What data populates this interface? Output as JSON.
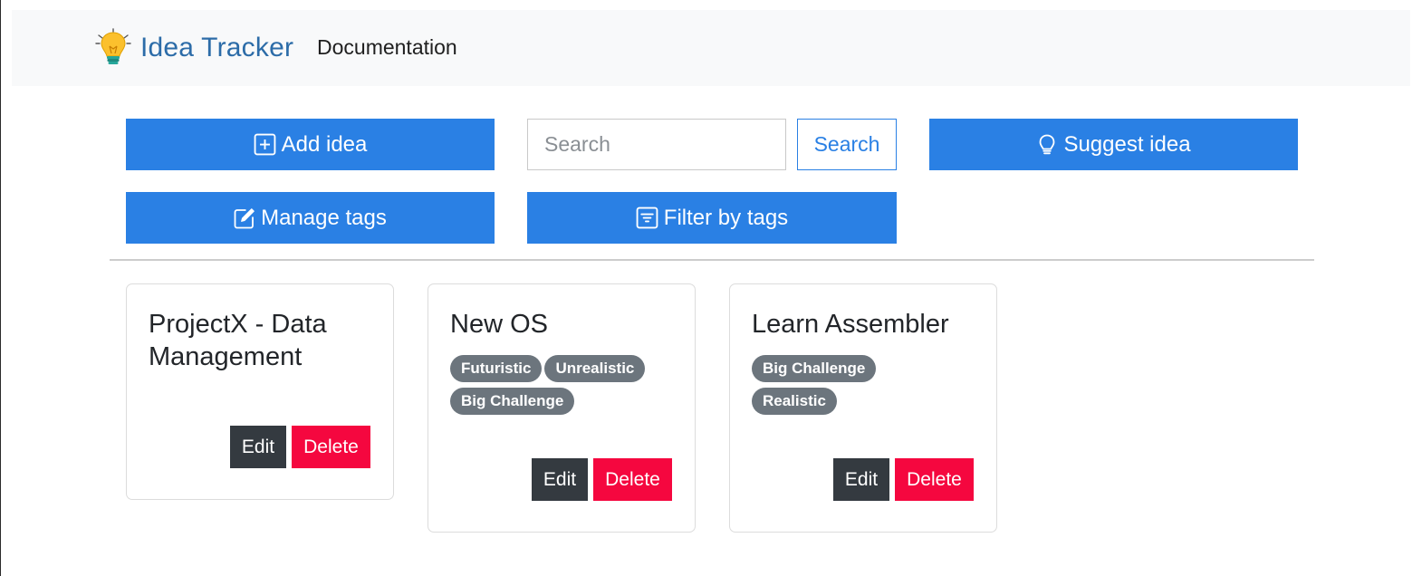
{
  "navbar": {
    "brand_icon": "lightbulb-icon",
    "brand": "Idea Tracker",
    "link_documentation": "Documentation"
  },
  "toolbar": {
    "add_idea": "Add idea",
    "add_icon": "plus-square-icon",
    "search_placeholder": "Search",
    "search_value": "",
    "search_button": "Search",
    "suggest_idea": "Suggest idea",
    "suggest_icon": "lightbulb-icon",
    "manage_tags": "Manage tags",
    "manage_icon": "pencil-square-icon",
    "filter_by_tags": "Filter by tags",
    "filter_icon": "filter-icon"
  },
  "ideas": [
    {
      "title": "ProjectX - Data Management",
      "tags": [],
      "edit_label": "Edit",
      "delete_label": "Delete"
    },
    {
      "title": "New OS",
      "tags": [
        "Futuristic",
        "Unrealistic",
        "Big Challenge"
      ],
      "edit_label": "Edit",
      "delete_label": "Delete"
    },
    {
      "title": "Learn Assembler",
      "tags": [
        "Big Challenge",
        "Realistic"
      ],
      "edit_label": "Edit",
      "delete_label": "Delete"
    }
  ],
  "colors": {
    "primary": "#2a80e4",
    "brand": "#2c6ca8",
    "navbar_bg": "#f8f9fa",
    "tag_bg": "#6c757d",
    "edit_bg": "#343a40",
    "delete_bg": "#f5073f"
  }
}
